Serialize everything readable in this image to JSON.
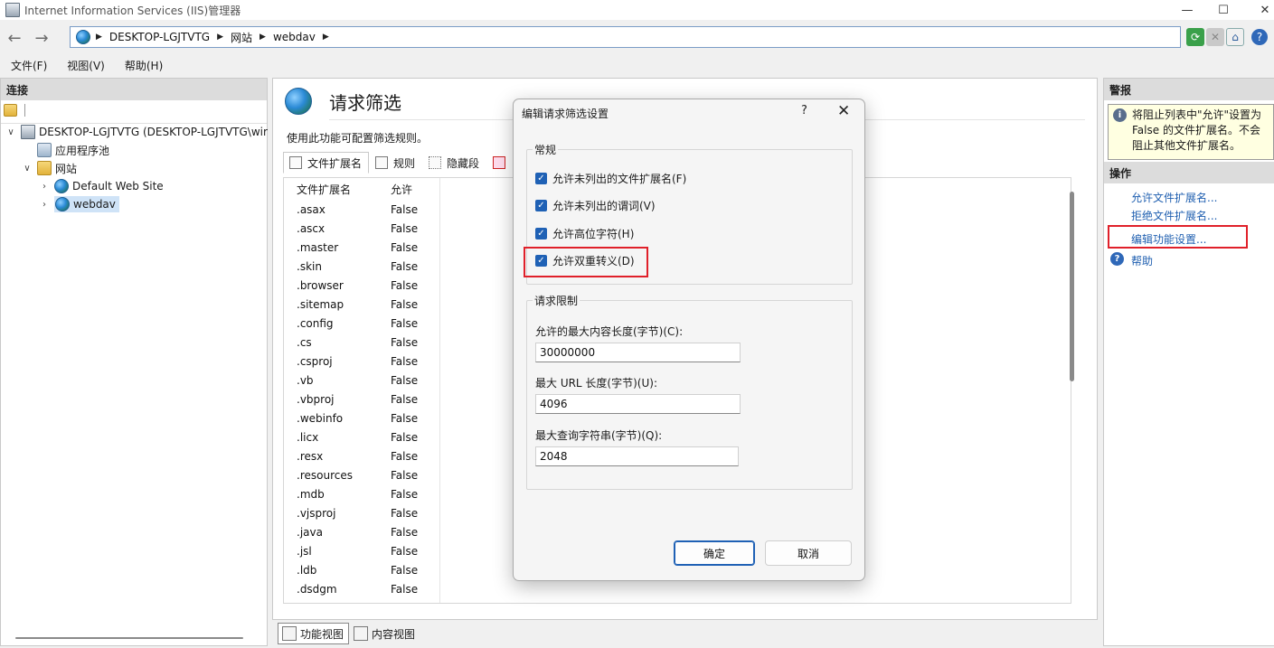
{
  "window": {
    "title": "Internet Information Services (IIS)管理器",
    "minimize": "—",
    "maximize": "☐",
    "close": "✕"
  },
  "address": {
    "crumbs": [
      "DESKTOP-LGJTVTG",
      "网站",
      "webdav"
    ]
  },
  "menu": [
    "文件(F)",
    "视图(V)",
    "帮助(H)"
  ],
  "connections": {
    "header": "连接",
    "tree": {
      "server": "DESKTOP-LGJTVTG (DESKTOP-LGJTVTG\\wir",
      "app_pools": "应用程序池",
      "sites": "网站",
      "default_site": "Default Web Site",
      "webdav": "webdav"
    }
  },
  "content": {
    "title": "请求筛选",
    "description": "使用此功能可配置筛选规则。",
    "tabs": [
      "文件扩展名",
      "规则",
      "隐藏段",
      ""
    ],
    "columns": [
      "文件扩展名",
      "允许"
    ],
    "rows": [
      [
        ".asax",
        "False"
      ],
      [
        ".ascx",
        "False"
      ],
      [
        ".master",
        "False"
      ],
      [
        ".skin",
        "False"
      ],
      [
        ".browser",
        "False"
      ],
      [
        ".sitemap",
        "False"
      ],
      [
        ".config",
        "False"
      ],
      [
        ".cs",
        "False"
      ],
      [
        ".csproj",
        "False"
      ],
      [
        ".vb",
        "False"
      ],
      [
        ".vbproj",
        "False"
      ],
      [
        ".webinfo",
        "False"
      ],
      [
        ".licx",
        "False"
      ],
      [
        ".resx",
        "False"
      ],
      [
        ".resources",
        "False"
      ],
      [
        ".mdb",
        "False"
      ],
      [
        ".vjsproj",
        "False"
      ],
      [
        ".java",
        "False"
      ],
      [
        ".jsl",
        "False"
      ],
      [
        ".ldb",
        "False"
      ],
      [
        ".dsdgm",
        "False"
      ]
    ],
    "views": {
      "feature": "功能视图",
      "content": "内容视图"
    }
  },
  "actions": {
    "alerts_header": "警报",
    "alert_text": "将阻止列表中\"允许\"设置为 False 的文件扩展名。不会阻止其他文件扩展名。",
    "operations_header": "操作",
    "links": [
      "允许文件扩展名...",
      "拒绝文件扩展名...",
      "编辑功能设置..."
    ],
    "help": "帮助"
  },
  "dialog": {
    "title": "编辑请求筛选设置",
    "help": "?",
    "close": "✕",
    "general_group": "常规",
    "checkboxes": [
      {
        "label": "允许未列出的文件扩展名(F)",
        "checked": true
      },
      {
        "label": "允许未列出的谓词(V)",
        "checked": true
      },
      {
        "label": "允许高位字符(H)",
        "checked": true
      },
      {
        "label": "允许双重转义(D)",
        "checked": true
      }
    ],
    "limits_group": "请求限制",
    "max_content_label": "允许的最大内容长度(字节)(C):",
    "max_content_value": "30000000",
    "max_url_label": "最大 URL 长度(字节)(U):",
    "max_url_value": "4096",
    "max_query_label": "最大查询字符串(字节)(Q):",
    "max_query_value": "2048",
    "ok": "确定",
    "cancel": "取消"
  },
  "colors": {
    "accent": "#1f61b5",
    "highlight": "#e0202a",
    "link": "#1f5fb0"
  }
}
